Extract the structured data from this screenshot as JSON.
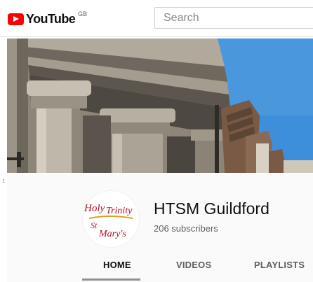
{
  "header": {
    "logo_text": "YouTube",
    "country_code": "GB",
    "search_placeholder": "Search"
  },
  "channel": {
    "avatar_text": [
      "Holy",
      "Trinity",
      "St",
      "Mary's"
    ],
    "name": "HTSM Guildford",
    "subscribers": "206 subscribers"
  },
  "tabs": [
    {
      "label": "HOME",
      "selected": true
    },
    {
      "label": "VIDEOS",
      "selected": false
    },
    {
      "label": "PLAYLISTS",
      "selected": false
    }
  ],
  "margin_mark": "1",
  "colors": {
    "brand_red": "#ff0000",
    "avatar_red": "#b0122b",
    "avatar_gold": "#d9a21b",
    "sky_blue": "#3d8fdc"
  }
}
